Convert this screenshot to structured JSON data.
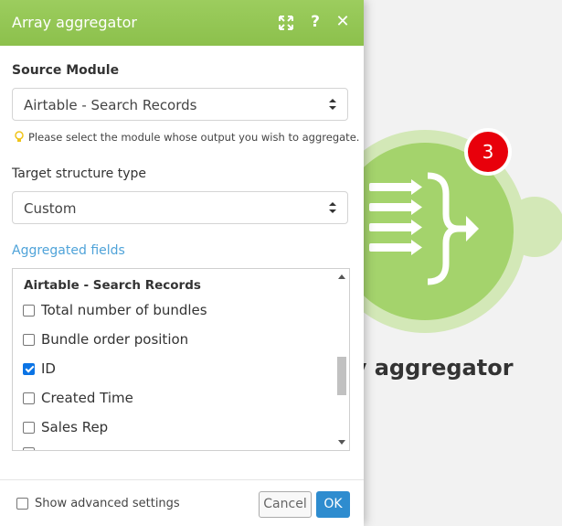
{
  "panel": {
    "title": "Array aggregator",
    "header_icons": [
      "expand-icon",
      "help-icon",
      "close-icon"
    ],
    "help_glyph": "?",
    "close_glyph": "✕"
  },
  "source_module": {
    "label": "Source Module",
    "value": "Airtable - Search Records",
    "hint": "Please select the module whose output you wish to aggregate."
  },
  "target_structure": {
    "label": "Target structure type",
    "value": "Custom"
  },
  "aggregated_fields": {
    "label": "Aggregated fields",
    "group_title": "Airtable - Search Records",
    "items": [
      {
        "label": "Total number of bundles",
        "checked": false
      },
      {
        "label": "Bundle order position",
        "checked": false
      },
      {
        "label": "ID",
        "checked": true
      },
      {
        "label": "Created Time",
        "checked": false
      },
      {
        "label": "Sales Rep",
        "checked": false
      }
    ]
  },
  "footer": {
    "advanced_label": "Show advanced settings",
    "cancel_label": "Cancel",
    "ok_label": "OK"
  },
  "module": {
    "badge_count": "3",
    "name": "Array aggregator"
  },
  "colors": {
    "header_green": "#8cc04c",
    "module_green": "#a4d36c",
    "badge_red": "#e8000b",
    "link_blue": "#4fa3d9",
    "ok_blue": "#2e8ccf"
  }
}
